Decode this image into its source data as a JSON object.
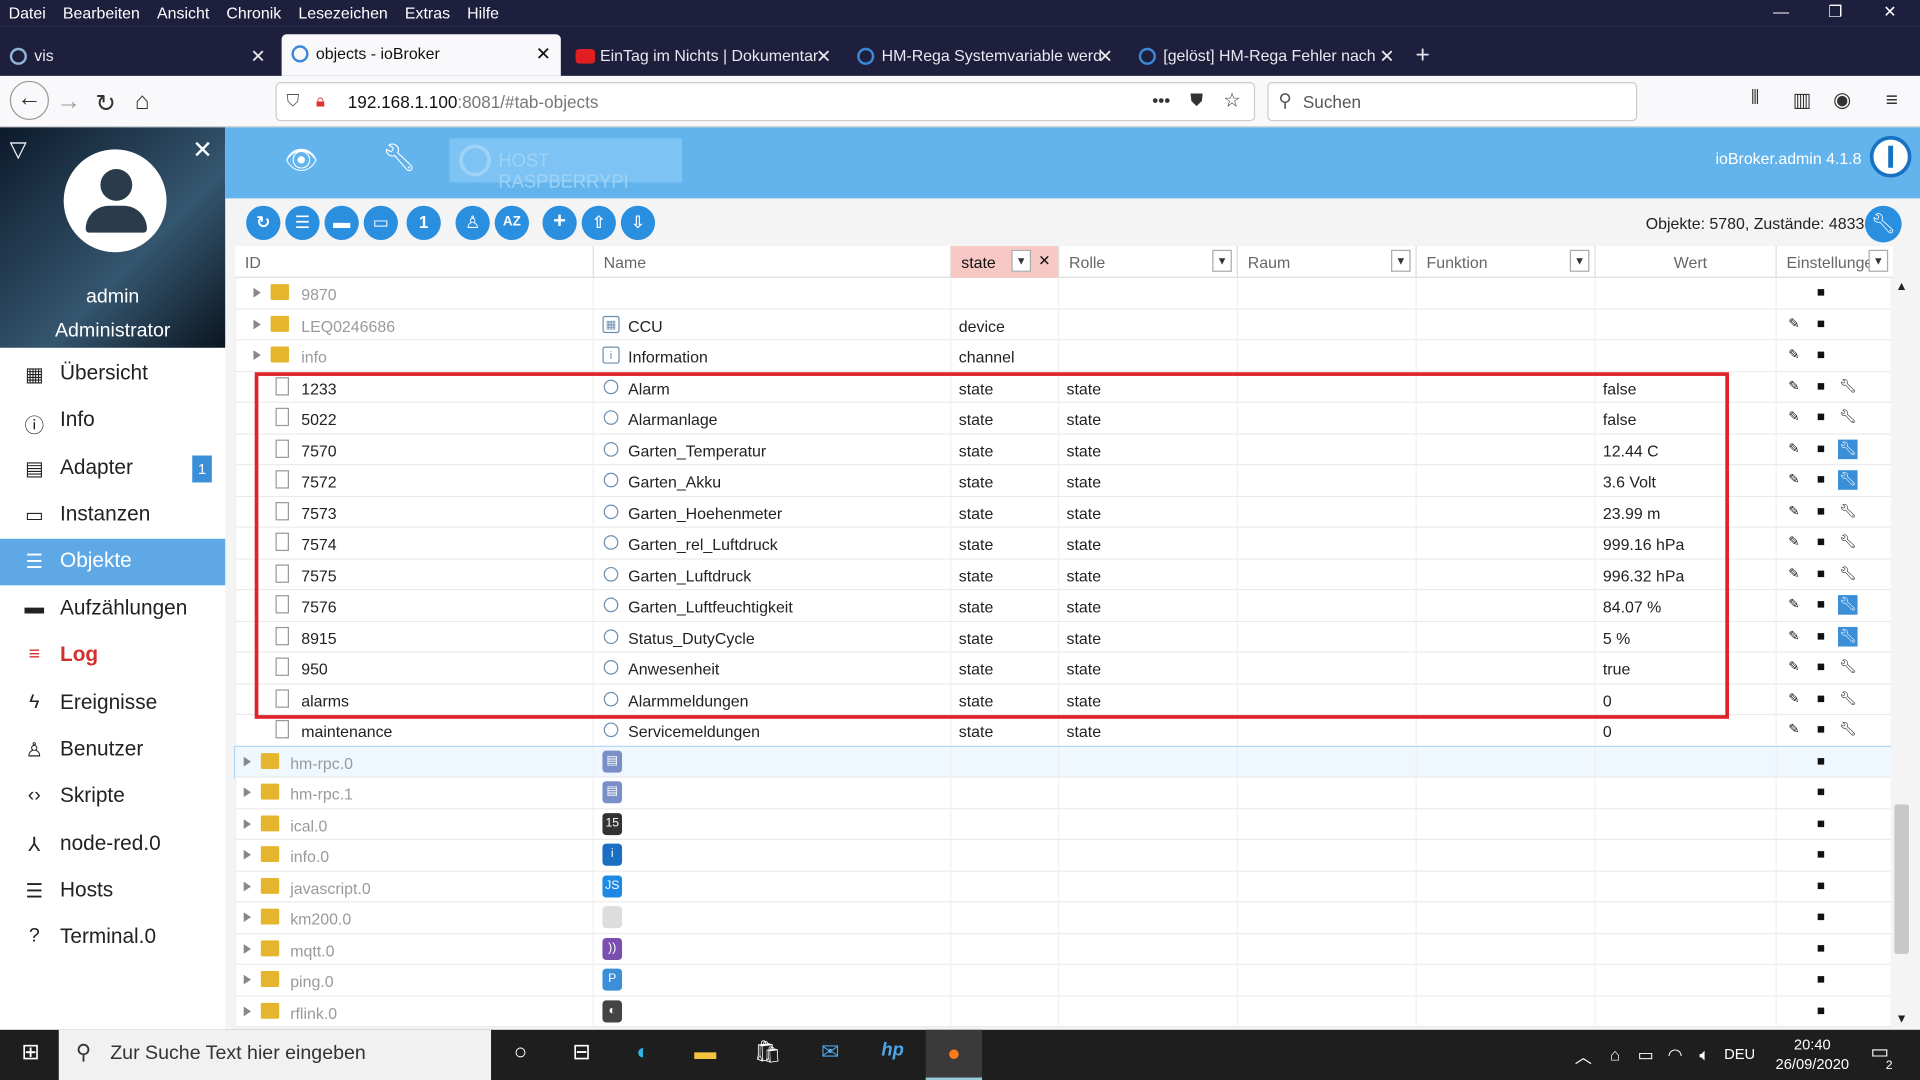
{
  "browser": {
    "menu": [
      "Datei",
      "Bearbeiten",
      "Ansicht",
      "Chronik",
      "Lesezeichen",
      "Extras",
      "Hilfe"
    ],
    "tabs": [
      {
        "label": "vis"
      },
      {
        "label": "objects - ioBroker"
      },
      {
        "label": "EinTag im Nichts | Dokumentar"
      },
      {
        "label": "HM-Rega Systemvariable werd"
      },
      {
        "label": "[gelöst] HM-Rega Fehler nach"
      }
    ],
    "url_host": "192.168.1.100",
    "url_rest": ":8081/#tab-objects",
    "search_placeholder": "Suchen",
    "dots": "•••"
  },
  "sidebar": {
    "user_name": "admin",
    "user_role": "Administrator",
    "items": [
      {
        "label": "Übersicht",
        "icon": "grid-icon"
      },
      {
        "label": "Info",
        "icon": "info-icon"
      },
      {
        "label": "Adapter",
        "icon": "store-icon",
        "badge": "1"
      },
      {
        "label": "Instanzen",
        "icon": "instances-icon"
      },
      {
        "label": "Objekte",
        "icon": "list-icon"
      },
      {
        "label": "Aufzählungen",
        "icon": "enum-icon"
      },
      {
        "label": "Log",
        "icon": "log-icon"
      },
      {
        "label": "Ereignisse",
        "icon": "bolt-icon"
      },
      {
        "label": "Benutzer",
        "icon": "user-icon"
      },
      {
        "label": "Skripte",
        "icon": "code-icon"
      },
      {
        "label": "node-red.0",
        "icon": "node-icon"
      },
      {
        "label": "Hosts",
        "icon": "hosts-icon"
      },
      {
        "label": "Terminal.0",
        "icon": "terminal-icon"
      }
    ]
  },
  "header": {
    "host_label": "HOST RASPBERRYPI",
    "version": "ioBroker.admin 4.1.8"
  },
  "toolbar": {
    "obj_count": "Objekte: 5780, Zustände: 4833",
    "az": "AZ",
    "num": "1"
  },
  "table": {
    "headers": {
      "id": "ID",
      "name": "Name",
      "type": "state",
      "role": "Rolle",
      "raum": "Raum",
      "funktion": "Funktion",
      "wert": "Wert",
      "einstellungen": "Einstellunge"
    },
    "rows": [
      {
        "id": "9870",
        "name": "",
        "type": "",
        "role": "",
        "value": ""
      },
      {
        "id": "LEQ0246686",
        "name": "CCU",
        "type": "device",
        "role": "",
        "value": ""
      },
      {
        "id": "info",
        "name": "Information",
        "type": "channel",
        "role": "",
        "value": ""
      },
      {
        "id": "1233",
        "name": "Alarm",
        "type": "state",
        "role": "state",
        "value": "false"
      },
      {
        "id": "5022",
        "name": "Alarmanlage",
        "type": "state",
        "role": "state",
        "value": "false"
      },
      {
        "id": "7570",
        "name": "Garten_Temperatur",
        "type": "state",
        "role": "state",
        "value": "12.44 C"
      },
      {
        "id": "7572",
        "name": "Garten_Akku",
        "type": "state",
        "role": "state",
        "value": "3.6 Volt"
      },
      {
        "id": "7573",
        "name": "Garten_Hoehenmeter",
        "type": "state",
        "role": "state",
        "value": "23.99 m"
      },
      {
        "id": "7574",
        "name": "Garten_rel_Luftdruck",
        "type": "state",
        "role": "state",
        "value": "999.16 hPa"
      },
      {
        "id": "7575",
        "name": "Garten_Luftdruck",
        "type": "state",
        "role": "state",
        "value": "996.32 hPa"
      },
      {
        "id": "7576",
        "name": "Garten_Luftfeuchtigkeit",
        "type": "state",
        "role": "state",
        "value": "84.07 %"
      },
      {
        "id": "8915",
        "name": "Status_DutyCycle",
        "type": "state",
        "role": "state",
        "value": "5 %"
      },
      {
        "id": "950",
        "name": "Anwesenheit",
        "type": "state",
        "role": "state",
        "value": "true"
      },
      {
        "id": "alarms",
        "name": "Alarmmeldungen",
        "type": "state",
        "role": "state",
        "value": "0"
      },
      {
        "id": "maintenance",
        "name": "Servicemeldungen",
        "type": "state",
        "role": "state",
        "value": "0"
      },
      {
        "id": "hm-rpc.0",
        "name": "",
        "type": "",
        "role": "",
        "value": ""
      },
      {
        "id": "hm-rpc.1",
        "name": "",
        "type": "",
        "role": "",
        "value": ""
      },
      {
        "id": "ical.0",
        "name": "",
        "type": "",
        "role": "",
        "value": ""
      },
      {
        "id": "info.0",
        "name": "",
        "type": "",
        "role": "",
        "value": ""
      },
      {
        "id": "javascript.0",
        "name": "",
        "type": "",
        "role": "",
        "value": ""
      },
      {
        "id": "km200.0",
        "name": "",
        "type": "",
        "role": "",
        "value": ""
      },
      {
        "id": "mqtt.0",
        "name": "",
        "type": "",
        "role": "",
        "value": ""
      },
      {
        "id": "ping.0",
        "name": "",
        "type": "",
        "role": "",
        "value": ""
      },
      {
        "id": "rflink.0",
        "name": "",
        "type": "",
        "role": "",
        "value": ""
      }
    ]
  },
  "taskbar": {
    "search_placeholder": "Zur Suche Text hier eingeben",
    "lang": "DEU",
    "time": "20:40",
    "date": "26/09/2020",
    "notif": "2"
  }
}
